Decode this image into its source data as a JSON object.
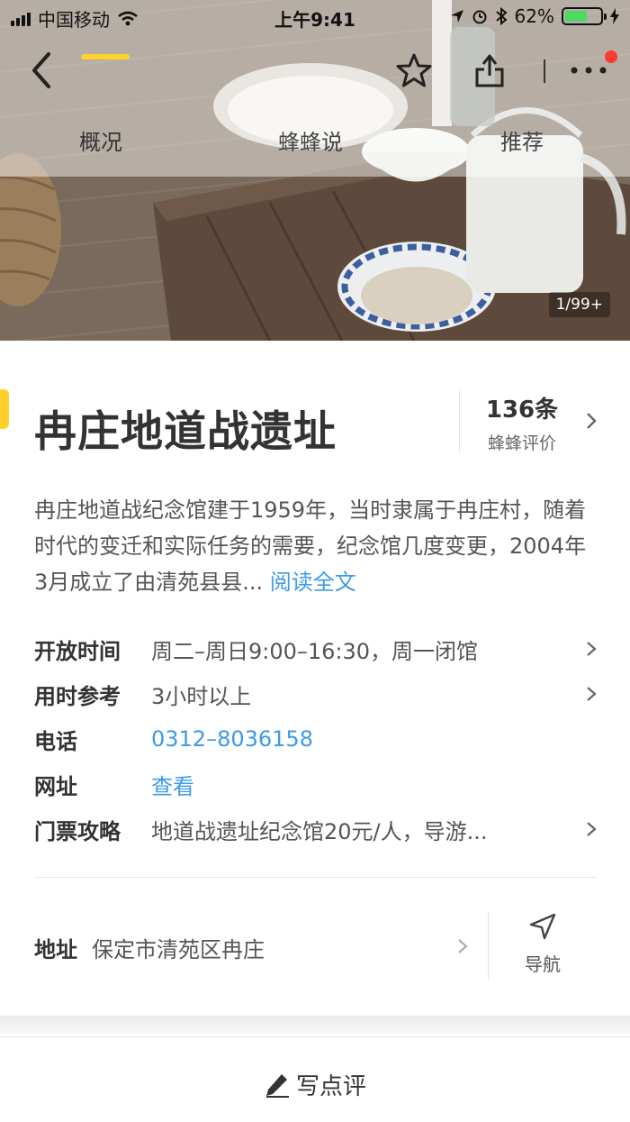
{
  "status_bar": {
    "carrier": "中国移动",
    "time": "上午9:41",
    "battery_text": "62%",
    "battery_level": 0.62
  },
  "nav": {
    "icons": [
      "back-icon",
      "star-icon",
      "share-icon",
      "more-icon"
    ]
  },
  "tabs": [
    {
      "label": "概况",
      "active": true
    },
    {
      "label": "蜂蜂说",
      "active": false
    },
    {
      "label": "推荐",
      "active": false
    }
  ],
  "hero": {
    "photo_count": "1/99+"
  },
  "poi": {
    "title": "冉庄地道战遗址",
    "review_count": "136条",
    "review_label": "蜂蜂评价",
    "description": "冉庄地道战纪念馆建于1959年，当时隶属于冉庄村，随着时代的变迁和实际任务的需要，纪念馆几度变更，2004年3月成立了由清苑县县...",
    "read_more": "阅读全文"
  },
  "info_rows": [
    {
      "key": "开放时间",
      "value": "周二–周日9:00–16:30，周一闭馆"
    },
    {
      "key": "用时参考",
      "value": "3小时以上"
    },
    {
      "key": "电话",
      "value": "0312–8036158"
    },
    {
      "key": "网址",
      "value": "查看"
    },
    {
      "key": "门票攻略",
      "value": "地道战遗址纪念馆20元/人，导游..."
    }
  ],
  "address": {
    "key": "地址",
    "value": "保定市清苑区冉庄",
    "navigate_label": "导航"
  },
  "bottom": {
    "write_review": "写点评"
  },
  "colors": {
    "accent_yellow": "#ffd12a",
    "link_blue": "#3d9be8",
    "notification_red": "#ff3b30"
  }
}
